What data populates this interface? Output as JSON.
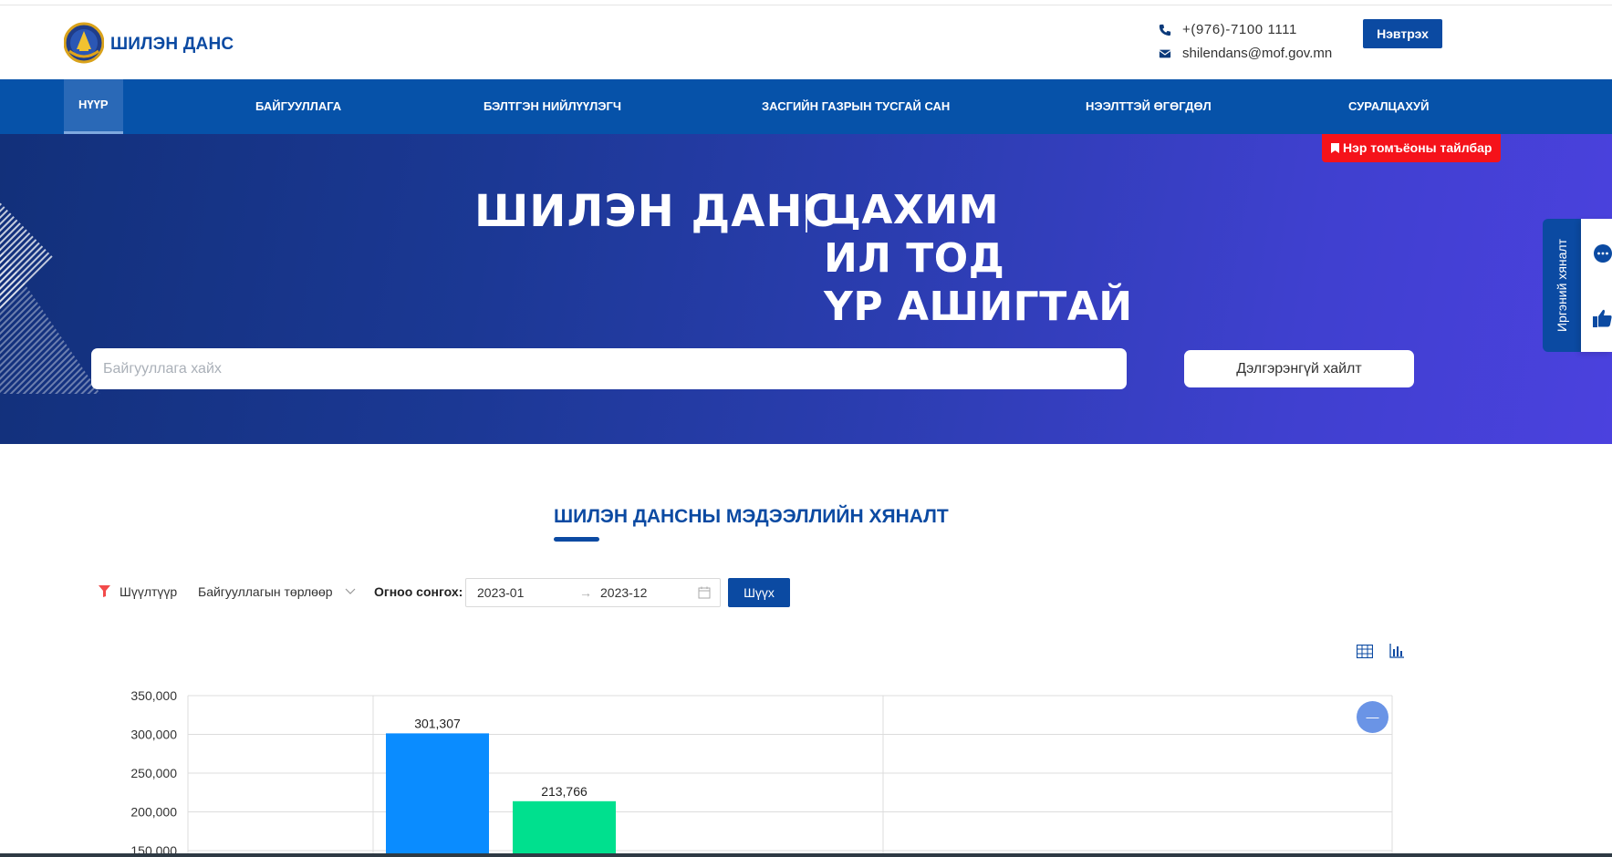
{
  "header": {
    "brand": "ШИЛЭН ДАНС",
    "phone": "+(976)-7100 1111",
    "email": "shilendans@mof.gov.mn",
    "login_label": "Нэвтрэх"
  },
  "nav": {
    "items": [
      {
        "label": "НҮҮР",
        "active": true
      },
      {
        "label": "БАЙГУУЛЛАГА"
      },
      {
        "label": "БЭЛТГЭН НИЙЛҮҮЛЭГЧ"
      },
      {
        "label": "ЗАСГИЙН ГАЗРЫН ТУСГАЙ САН"
      },
      {
        "label": "НЭЭЛТТЭЙ ӨГӨГДӨЛ"
      },
      {
        "label": "СУРАЛЦАХУЙ"
      }
    ]
  },
  "hero": {
    "title": "ШИЛЭН ДАНС",
    "tagline": [
      "ЦАХИМ",
      "ИЛ ТОД",
      "ҮР АШИГТАЙ"
    ],
    "notice": "Нэр томъёоны тайлбар",
    "search_placeholder": "Байгууллага хайх",
    "advanced_search": "Дэлгэрэнгүй хайлт"
  },
  "side_widget": {
    "label": "Иргэний хяналт",
    "icons": [
      "chat-icon",
      "thumbs-up-icon"
    ]
  },
  "section": {
    "title": "ШИЛЭН ДАНСНЫ МЭДЭЭЛЛИЙН ХЯНАЛТ",
    "filter_label": "Шүүлтүүр",
    "org_type_select": "Байгууллагын төрлөөр",
    "date_label": "Огноо сонгох:",
    "date_from": "2023-01",
    "date_to": "2023-12",
    "filter_button": "Шүүх",
    "zoom_button": "—"
  },
  "colors": {
    "brand_blue": "#0b4aa2",
    "nav_blue": "#0652a9",
    "notice_red": "#f5121a",
    "bar_blue": "#0a8cff",
    "bar_green": "#00e08e"
  },
  "chart_data": {
    "type": "bar",
    "ylim": [
      150000,
      350000
    ],
    "yticks": [
      "350,000",
      "300,000",
      "250,000",
      "200,000",
      "150,000"
    ],
    "series": [
      {
        "values": [
          301307
        ],
        "color": "#0a8cff"
      },
      {
        "values": [
          213766
        ],
        "color": "#00e08e"
      }
    ],
    "data_labels": [
      "301,307",
      "213,766"
    ],
    "grid": true
  }
}
